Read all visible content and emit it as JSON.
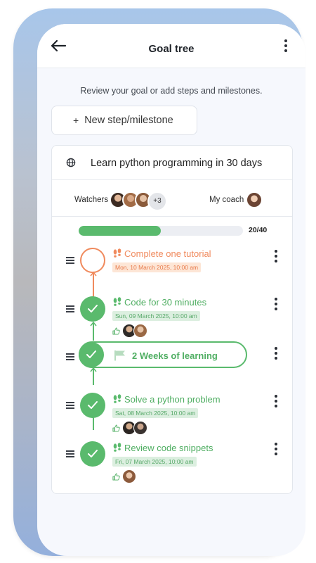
{
  "header": {
    "title": "Goal tree"
  },
  "subtitle": "Review your goal or add steps and milestones.",
  "new_button": {
    "plus": "+",
    "label": "New step/milestone"
  },
  "goal": {
    "title": "Learn python programming in 30 days",
    "watchers_label": "Watchers",
    "watchers_more": "+3",
    "coach_label": "My coach",
    "progress_text": "20/40",
    "progress_fraction": 0.5
  },
  "items": [
    {
      "type": "step",
      "status": "todo",
      "title": "Complete one tutorial",
      "date": "Mon, 10 March 2025, 10:00 am",
      "likes": 0
    },
    {
      "type": "step",
      "status": "done",
      "title": "Code for 30 minutes",
      "date": "Sun, 09 March 2025, 10:00 am",
      "likes": 2
    },
    {
      "type": "milestone",
      "status": "done",
      "title": "2 Weeks of learning"
    },
    {
      "type": "step",
      "status": "done",
      "title": "Solve a python problem",
      "date": "Sat, 08 March 2025, 10:00 am",
      "likes": 2
    },
    {
      "type": "step",
      "status": "done",
      "title": "Review code snippets",
      "date": "Fri, 07 March 2025, 10:00 am",
      "likes": 1
    }
  ],
  "colors": {
    "accent_green": "#5aba6d",
    "todo_orange": "#f08a5d"
  },
  "icons": [
    "back-arrow-icon",
    "more-vertical-icon",
    "globe-icon",
    "drag-handle-icon",
    "footsteps-icon",
    "flag-icon",
    "thumbs-up-icon",
    "checkmark-icon"
  ]
}
